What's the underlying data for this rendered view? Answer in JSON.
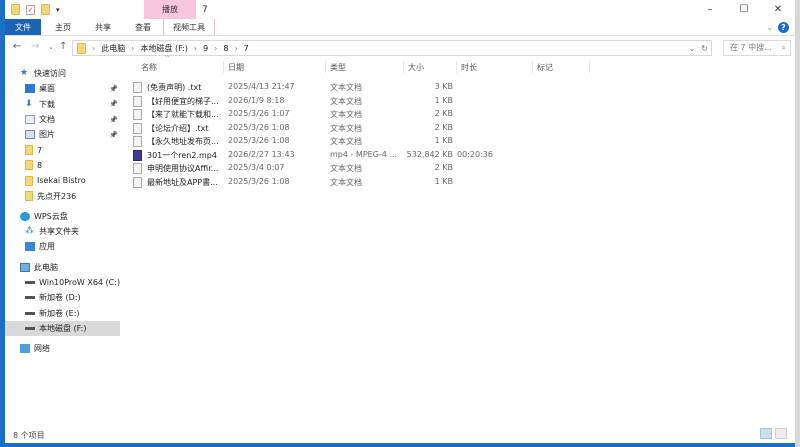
{
  "window": {
    "title": "7",
    "context_tab_header": "播放",
    "controls": [
      "–",
      "☐",
      "✕"
    ]
  },
  "ribbon": {
    "tabs": [
      "文件",
      "主页",
      "共享",
      "查看",
      "视频工具"
    ]
  },
  "address": {
    "breadcrumb": [
      "此电脑",
      "本地磁盘 (F:)",
      "9",
      "8",
      "7"
    ],
    "search_placeholder": "在 7 中搜..."
  },
  "sidebar": {
    "items": [
      {
        "label": "快速访问",
        "icon": "star-icon",
        "level": 1
      },
      {
        "label": "桌面",
        "icon": "desktop-icon",
        "pinned": true
      },
      {
        "label": "下载",
        "icon": "download-icon",
        "pinned": true
      },
      {
        "label": "文档",
        "icon": "document-icon",
        "pinned": true
      },
      {
        "label": "图片",
        "icon": "picture-icon",
        "pinned": true
      },
      {
        "label": "7",
        "icon": "folder-icon"
      },
      {
        "label": "8",
        "icon": "folder-icon"
      },
      {
        "label": "Isekai Bistro",
        "icon": "folder-icon"
      },
      {
        "label": "先点开236",
        "icon": "folder-icon"
      },
      {
        "label": "WPS云盘",
        "icon": "cloud-icon",
        "level": 1,
        "gap": true
      },
      {
        "label": "共享文件夹",
        "icon": "share-icon"
      },
      {
        "label": "应用",
        "icon": "apps-icon"
      },
      {
        "label": "此电脑",
        "icon": "computer-icon",
        "level": 1,
        "gap": true
      },
      {
        "label": "Win10ProW X64 (C:)",
        "icon": "drive-icon"
      },
      {
        "label": "新加卷 (D:)",
        "icon": "drive-icon"
      },
      {
        "label": "新加卷 (E:)",
        "icon": "drive-icon"
      },
      {
        "label": "本地磁盘 (F:)",
        "icon": "drive-icon",
        "selected": true
      },
      {
        "label": "网络",
        "icon": "network-icon",
        "level": 1,
        "gap": true
      }
    ]
  },
  "columns": [
    "名称",
    "日期",
    "类型",
    "大小",
    "时长",
    "标记"
  ],
  "files": [
    {
      "name": "(免责声明) .txt",
      "date": "2025/4/13 21:47",
      "type": "文本文档",
      "size": "3 KB",
      "duration": ""
    },
    {
      "name": "【好用便宜的梯子...",
      "date": "2026/1/9 8:18",
      "type": "文本文档",
      "size": "1 KB",
      "duration": ""
    },
    {
      "name": "【来了就能下载和...",
      "date": "2025/3/26 1:07",
      "type": "文本文档",
      "size": "2 KB",
      "duration": ""
    },
    {
      "name": "【论坛介绍】.txt",
      "date": "2025/3/26 1:08",
      "type": "文本文档",
      "size": "2 KB",
      "duration": ""
    },
    {
      "name": "【永久地址发布页...",
      "date": "2025/3/26 1:08",
      "type": "文本文档",
      "size": "1 KB",
      "duration": ""
    },
    {
      "name": "301一个ren2.mp4",
      "date": "2026/2/27 13:43",
      "type": "mp4 - MPEG-4 ...",
      "size": "532,842 KB",
      "duration": "00:20:36",
      "video": true
    },
    {
      "name": "申明使用协议Affir...",
      "date": "2025/3/4 0:07",
      "type": "文本文档",
      "size": "2 KB",
      "duration": ""
    },
    {
      "name": "最新地址及APP書...",
      "date": "2025/3/26 1:08",
      "type": "文本文档",
      "size": "1 KB",
      "duration": ""
    }
  ],
  "status": {
    "count": "8 个项目"
  },
  "colors": {
    "file_tab": "#1a63b5",
    "context_tab": "#f7c6dd",
    "selected": "#d9d9d9"
  }
}
